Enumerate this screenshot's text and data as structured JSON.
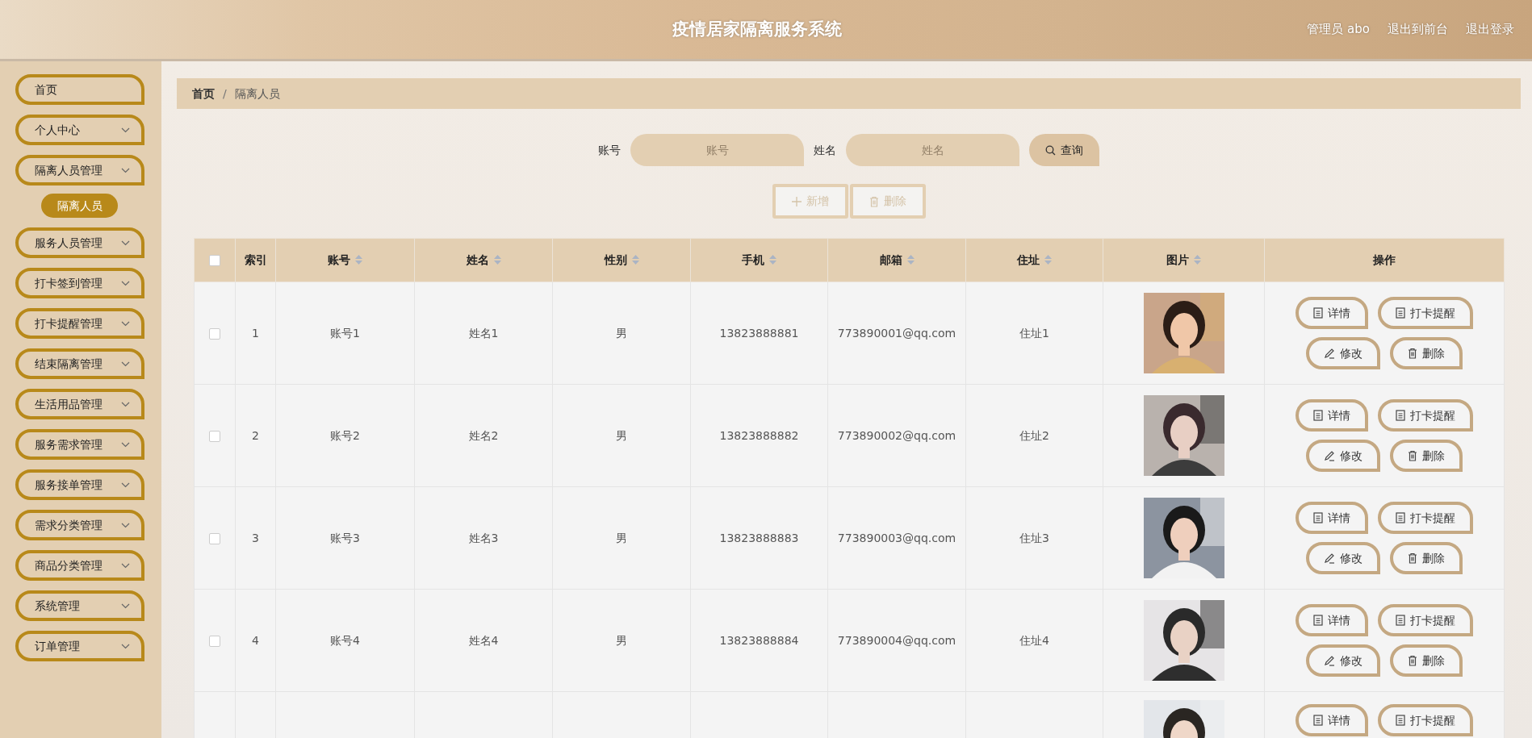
{
  "header": {
    "title": "疫情居家隔离服务系统",
    "user": "管理员 abo",
    "links": [
      "退出到前台",
      "退出登录"
    ]
  },
  "sidebar": {
    "items": [
      {
        "label": "首页",
        "kind": "link"
      },
      {
        "label": "个人中心",
        "kind": "group"
      },
      {
        "label": "隔离人员管理",
        "kind": "group",
        "children": [
          {
            "label": "隔离人员",
            "selected": true
          }
        ]
      },
      {
        "label": "服务人员管理",
        "kind": "group"
      },
      {
        "label": "打卡签到管理",
        "kind": "group"
      },
      {
        "label": "打卡提醒管理",
        "kind": "group"
      },
      {
        "label": "结束隔离管理",
        "kind": "group"
      },
      {
        "label": "生活用品管理",
        "kind": "group"
      },
      {
        "label": "服务需求管理",
        "kind": "group"
      },
      {
        "label": "服务接单管理",
        "kind": "group"
      },
      {
        "label": "需求分类管理",
        "kind": "group"
      },
      {
        "label": "商品分类管理",
        "kind": "group"
      },
      {
        "label": "系统管理",
        "kind": "group"
      },
      {
        "label": "订单管理",
        "kind": "group"
      }
    ]
  },
  "breadcrumb": {
    "items": [
      "首页",
      "隔离人员"
    ],
    "separator": "/"
  },
  "search": {
    "fields": [
      {
        "label": "账号",
        "placeholder": "账号"
      },
      {
        "label": "姓名",
        "placeholder": "姓名"
      }
    ],
    "button": "查询"
  },
  "toolbar": [
    {
      "label": "新增",
      "kind": "add"
    },
    {
      "label": "删除",
      "kind": "delete"
    }
  ],
  "table": {
    "all_checked": false,
    "columns": [
      {
        "label": "索引",
        "sortable": false
      },
      {
        "label": "账号",
        "sortable": true
      },
      {
        "label": "姓名",
        "sortable": true
      },
      {
        "label": "性别",
        "sortable": true
      },
      {
        "label": "手机",
        "sortable": true
      },
      {
        "label": "邮箱",
        "sortable": true
      },
      {
        "label": "住址",
        "sortable": true
      },
      {
        "label": "图片",
        "sortable": true
      },
      {
        "label": "操作",
        "sortable": false
      }
    ],
    "rows": [
      {
        "checked": false,
        "cells": [
          "1",
          "账号1",
          "姓名1",
          "男",
          "13823888881",
          "773890001@qq.com",
          "住址1"
        ],
        "photo": {
          "kind": "picture"
        },
        "actions": [
          {
            "kind": "detail",
            "label": "详情"
          },
          {
            "kind": "remind",
            "label": "打卡提醒"
          },
          {
            "kind": "edit",
            "label": "修改"
          },
          {
            "kind": "delete",
            "label": "删除"
          }
        ]
      },
      {
        "checked": false,
        "cells": [
          "2",
          "账号2",
          "姓名2",
          "男",
          "13823888882",
          "773890002@qq.com",
          "住址2"
        ],
        "photo": {
          "kind": "picture"
        },
        "actions": [
          {
            "kind": "detail",
            "label": "详情"
          },
          {
            "kind": "remind",
            "label": "打卡提醒"
          },
          {
            "kind": "edit",
            "label": "修改"
          },
          {
            "kind": "delete",
            "label": "删除"
          }
        ]
      },
      {
        "checked": false,
        "cells": [
          "3",
          "账号3",
          "姓名3",
          "男",
          "13823888883",
          "773890003@qq.com",
          "住址3"
        ],
        "photo": {
          "kind": "picture"
        },
        "actions": [
          {
            "kind": "detail",
            "label": "详情"
          },
          {
            "kind": "remind",
            "label": "打卡提醒"
          },
          {
            "kind": "edit",
            "label": "修改"
          },
          {
            "kind": "delete",
            "label": "删除"
          }
        ]
      },
      {
        "checked": false,
        "cells": [
          "4",
          "账号4",
          "姓名4",
          "男",
          "13823888884",
          "773890004@qq.com",
          "住址4"
        ],
        "photo": {
          "kind": "picture"
        },
        "actions": [
          {
            "kind": "detail",
            "label": "详情"
          },
          {
            "kind": "remind",
            "label": "打卡提醒"
          },
          {
            "kind": "edit",
            "label": "修改"
          },
          {
            "kind": "delete",
            "label": "删除"
          }
        ]
      },
      {
        "photo": {
          "kind": "picture"
        },
        "actions": [
          {
            "kind": "detail",
            "label": "详情"
          },
          {
            "kind": "remind",
            "label": "打卡提醒"
          }
        ]
      }
    ]
  }
}
